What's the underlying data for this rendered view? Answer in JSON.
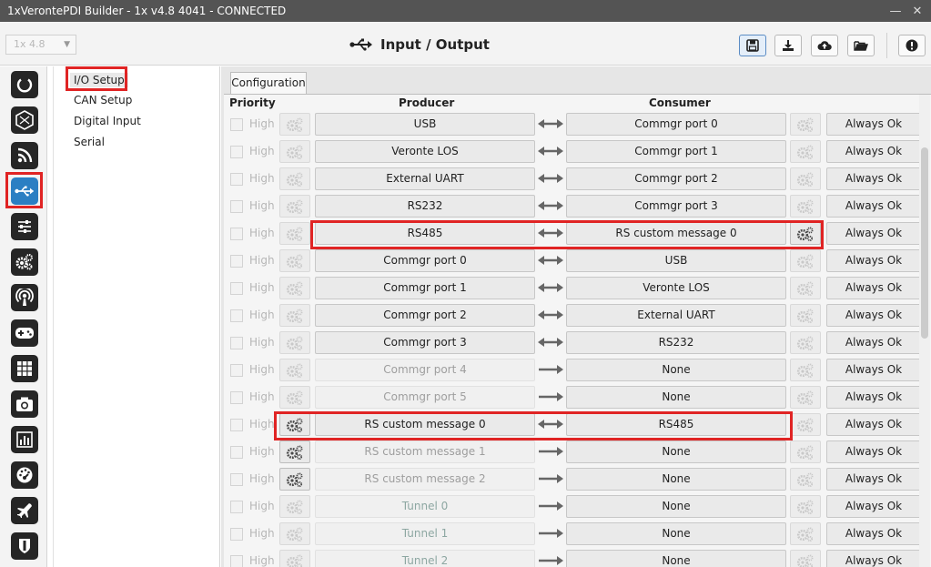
{
  "window": {
    "title": "1xVerontePDI Builder - 1x v4.8 4041 - CONNECTED"
  },
  "header": {
    "version_value": "1x 4.8",
    "title": "Input / Output",
    "buttons": [
      {
        "icon": "save-icon"
      },
      {
        "icon": "download-icon"
      },
      {
        "icon": "cloud-upload-icon"
      },
      {
        "icon": "folder-open-icon"
      },
      {
        "icon": "info-icon"
      }
    ]
  },
  "nav_icons": [
    "power-icon",
    "hexagon-icon",
    "rss-icon",
    "usb-icon",
    "sliders-icon",
    "gears-icon",
    "broadcast-icon",
    "gamepad-icon",
    "grid-icon",
    "camera-icon",
    "bar-chart-icon",
    "gauge-icon",
    "airplane-icon",
    "shield-icon"
  ],
  "submenu": {
    "items": [
      {
        "label": "I/O Setup"
      },
      {
        "label": "CAN Setup"
      },
      {
        "label": "Digital Input"
      },
      {
        "label": "Serial"
      }
    ]
  },
  "content": {
    "tab_label": "Configuration",
    "columns": {
      "priority": "Priority",
      "producer": "Producer",
      "consumer": "Consumer"
    },
    "priority_label": "High",
    "rows": [
      {
        "producer": "USB",
        "consumer": "Commgr port 0",
        "status": "Always Ok"
      },
      {
        "producer": "Veronte LOS",
        "consumer": "Commgr port 1",
        "status": "Always Ok"
      },
      {
        "producer": "External UART",
        "consumer": "Commgr port 2",
        "status": "Always Ok"
      },
      {
        "producer": "RS232",
        "consumer": "Commgr port 3",
        "status": "Always Ok"
      },
      {
        "producer": "RS485",
        "consumer": "RS custom message 0",
        "status": "Always Ok"
      },
      {
        "producer": "Commgr port 0",
        "consumer": "USB",
        "status": "Always Ok"
      },
      {
        "producer": "Commgr port 1",
        "consumer": "Veronte LOS",
        "status": "Always Ok"
      },
      {
        "producer": "Commgr port 2",
        "consumer": "External UART",
        "status": "Always Ok"
      },
      {
        "producer": "Commgr port 3",
        "consumer": "RS232",
        "status": "Always Ok"
      },
      {
        "producer": "Commgr port 4",
        "consumer": "None",
        "status": "Always Ok"
      },
      {
        "producer": "Commgr port 5",
        "consumer": "None",
        "status": "Always Ok"
      },
      {
        "producer": "RS custom message 0",
        "consumer": "RS485",
        "status": "Always Ok"
      },
      {
        "producer": "RS custom message 1",
        "consumer": "None",
        "status": "Always Ok"
      },
      {
        "producer": "RS custom message 2",
        "consumer": "None",
        "status": "Always Ok"
      },
      {
        "producer": "Tunnel 0",
        "consumer": "None",
        "status": "Always Ok"
      },
      {
        "producer": "Tunnel 1",
        "consumer": "None",
        "status": "Always Ok"
      },
      {
        "producer": "Tunnel 2",
        "consumer": "None",
        "status": "Always Ok"
      }
    ]
  },
  "colors": {
    "highlight": "#e02424",
    "active_nav": "#2b7fc3"
  }
}
